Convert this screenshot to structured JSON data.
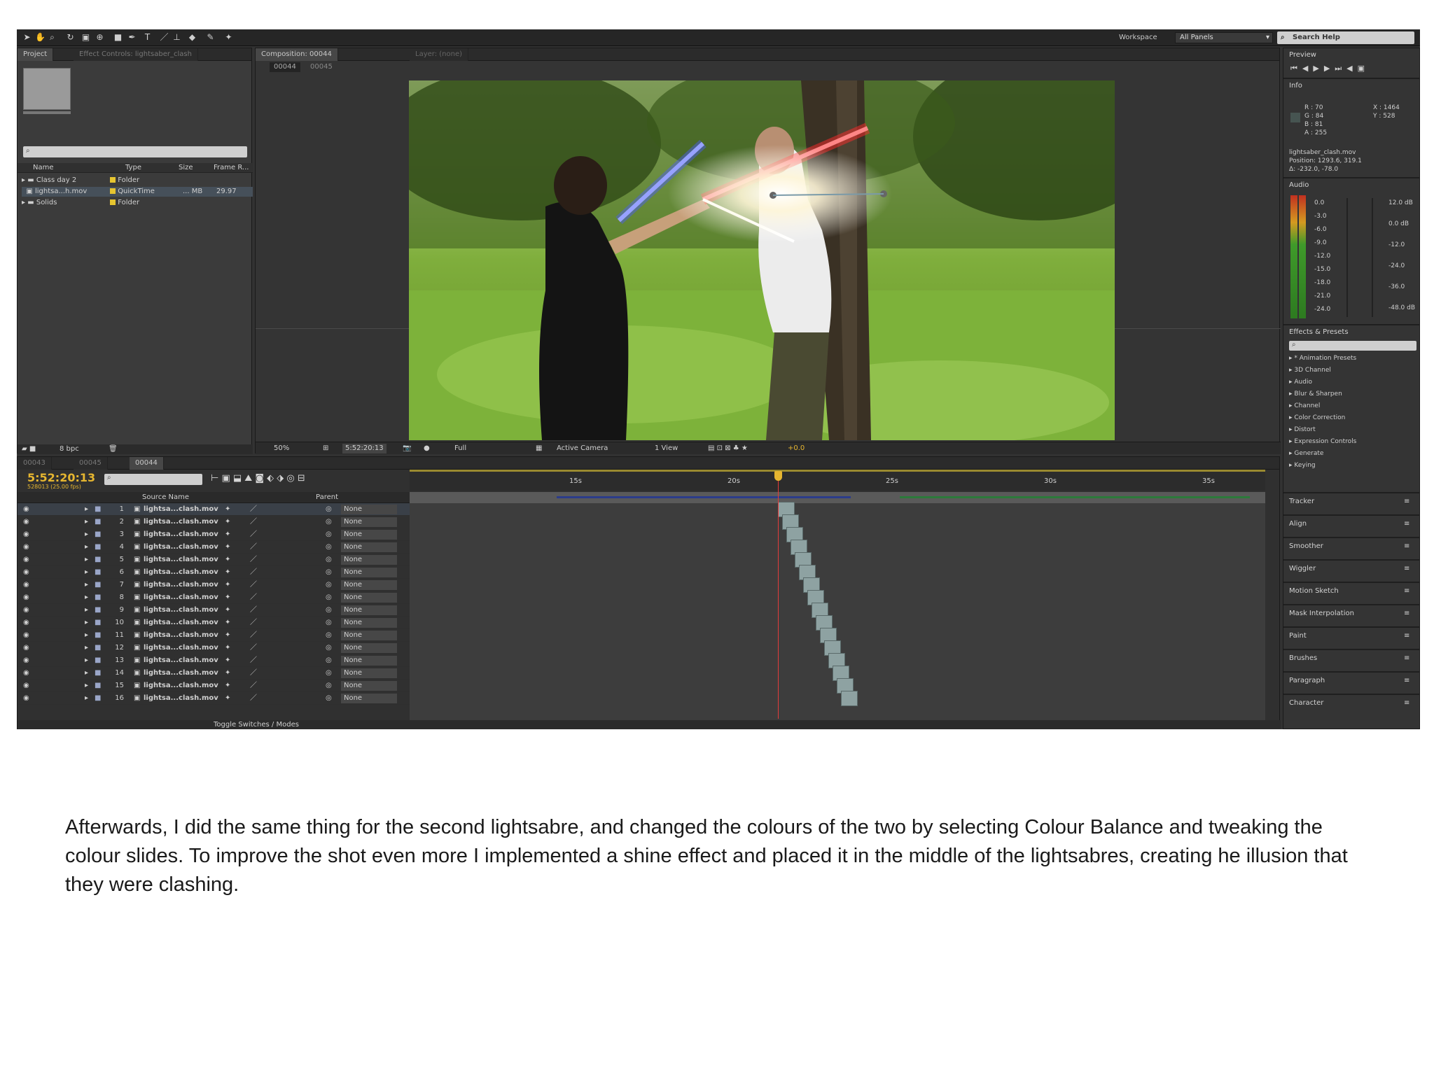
{
  "toolbar": {
    "workspace_label": "Workspace",
    "workspace_value": "All Panels",
    "search_help": "Search Help"
  },
  "project_panel": {
    "tab_project": "Project",
    "tab_effect_controls": "Effect Controls: lightsaber_clash",
    "columns": [
      "Name",
      "Type",
      "Size",
      "Frame R..."
    ],
    "items": [
      {
        "name": "Class day 2",
        "type": "Folder",
        "size": "",
        "rate": ""
      },
      {
        "name": "lightsa...h.mov",
        "type": "QuickTime",
        "size": "... MB",
        "rate": "29.97"
      },
      {
        "name": "Solids",
        "type": "Folder",
        "size": "",
        "rate": ""
      }
    ],
    "bpc": "8 bpc"
  },
  "composition_panel": {
    "tab_composition": "Composition: 00044",
    "tab_layer": "Layer: (none)",
    "breadcrumb": [
      "00044",
      "00045"
    ],
    "zoom": "50%",
    "timecode": "5:52:20:13",
    "resolution": "Full",
    "camera": "Active Camera",
    "view": "1 View",
    "exposure": "+0.0"
  },
  "timeline": {
    "tabs": [
      "00043",
      "00045",
      "00044"
    ],
    "timecode": "5:52:20:13",
    "fps_label": "528013 (25.00 fps)",
    "col_source": "Source Name",
    "col_parent": "Parent",
    "ruler": [
      "15s",
      "20s",
      "25s",
      "30s",
      "35s"
    ],
    "layers": [
      {
        "num": "1",
        "name": "lightsa...clash.mov",
        "parent": "None"
      },
      {
        "num": "2",
        "name": "lightsa...clash.mov",
        "parent": "None"
      },
      {
        "num": "3",
        "name": "lightsa...clash.mov",
        "parent": "None"
      },
      {
        "num": "4",
        "name": "lightsa...clash.mov",
        "parent": "None"
      },
      {
        "num": "5",
        "name": "lightsa...clash.mov",
        "parent": "None"
      },
      {
        "num": "6",
        "name": "lightsa...clash.mov",
        "parent": "None"
      },
      {
        "num": "7",
        "name": "lightsa...clash.mov",
        "parent": "None"
      },
      {
        "num": "8",
        "name": "lightsa...clash.mov",
        "parent": "None"
      },
      {
        "num": "9",
        "name": "lightsa...clash.mov",
        "parent": "None"
      },
      {
        "num": "10",
        "name": "lightsa...clash.mov",
        "parent": "None"
      },
      {
        "num": "11",
        "name": "lightsa...clash.mov",
        "parent": "None"
      },
      {
        "num": "12",
        "name": "lightsa...clash.mov",
        "parent": "None"
      },
      {
        "num": "13",
        "name": "lightsa...clash.mov",
        "parent": "None"
      },
      {
        "num": "14",
        "name": "lightsa...clash.mov",
        "parent": "None"
      },
      {
        "num": "15",
        "name": "lightsa...clash.mov",
        "parent": "None"
      },
      {
        "num": "16",
        "name": "lightsa...clash.mov",
        "parent": "None"
      }
    ],
    "toggle_label": "Toggle Switches / Modes"
  },
  "right_panels": {
    "preview": "Preview",
    "info": "Info",
    "info_values": {
      "r": "R : 70",
      "g": "G : 84",
      "b": "B : 81",
      "a": "A : 255",
      "x": "X : 1464",
      "y": "Y : 528"
    },
    "info_file": "lightsaber_clash.mov",
    "info_position": "Position: 1293.6, 319.1",
    "info_delta": "Δ: -232.0, -78.0",
    "audio": "Audio",
    "audio_left": [
      "0.0",
      "-3.0",
      "-6.0",
      "-9.0",
      "-12.0",
      "-15.0",
      "-18.0",
      "-21.0",
      "-24.0"
    ],
    "audio_right": [
      "12.0 dB",
      "0.0 dB",
      "-12.0",
      "-24.0",
      "-36.0",
      "-48.0 dB"
    ],
    "effects": "Effects & Presets",
    "effects_list": [
      "* Animation Presets",
      "3D Channel",
      "Audio",
      "Blur & Sharpen",
      "Channel",
      "Color Correction",
      "Distort",
      "Expression Controls",
      "Generate",
      "Keying"
    ],
    "collapsed": [
      "Tracker",
      "Align",
      "Smoother",
      "Wiggler",
      "Motion Sketch",
      "Mask Interpolation",
      "Paint",
      "Brushes",
      "Paragraph",
      "Character"
    ]
  },
  "caption": "Afterwards, I did the same thing for the second lightsabre, and changed the colours of the two by selecting Colour Balance and tweaking the colour slides. To improve the shot even more I implemented a shine effect and placed it in the middle of the lightsabres, creating he illusion that they were clashing."
}
